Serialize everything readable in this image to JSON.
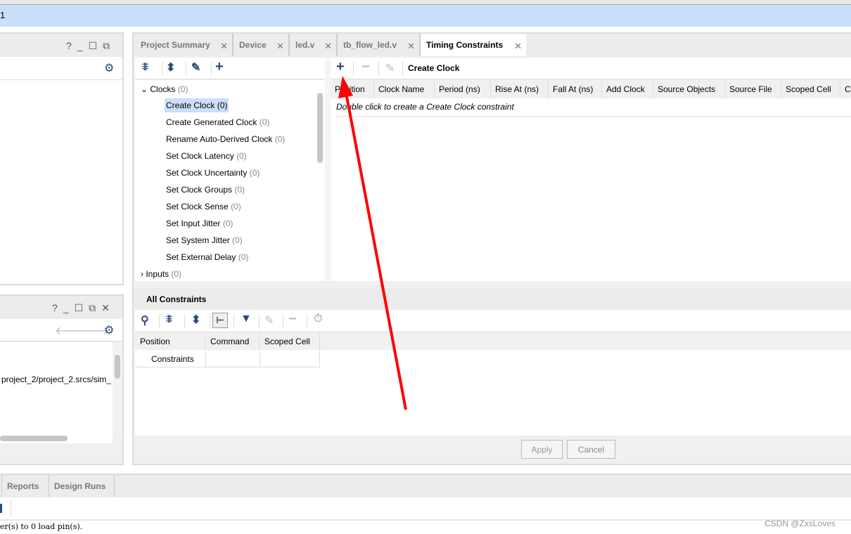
{
  "window": {
    "title_fragment": "1"
  },
  "left_top_panel": {
    "controls": [
      "?",
      "_",
      "☐",
      "⧉"
    ]
  },
  "left_bottom_panel": {
    "controls": [
      "?",
      "_",
      "☐",
      "⧉",
      "✕"
    ],
    "path_text": "project_2/project_2.srcs/sim_"
  },
  "main": {
    "tabs": [
      {
        "label": "Project Summary"
      },
      {
        "label": "Device"
      },
      {
        "label": "led.v"
      },
      {
        "label": "tb_flow_led.v"
      },
      {
        "label": "Timing Constraints",
        "active": true
      }
    ],
    "tree": {
      "groups": [
        {
          "label": "Clocks",
          "count": "(0)"
        },
        {
          "label": "Inputs",
          "count": "(0)"
        }
      ],
      "items": [
        {
          "label": "Create Clock (0)",
          "selected": true
        },
        {
          "label": "Create Generated Clock",
          "count": "(0)"
        },
        {
          "label": "Rename Auto-Derived Clock",
          "count": "(0)"
        },
        {
          "label": "Set Clock Latency",
          "count": "(0)"
        },
        {
          "label": "Set Clock Uncertainty",
          "count": "(0)"
        },
        {
          "label": "Set Clock Groups",
          "count": "(0)"
        },
        {
          "label": "Set Clock Sense",
          "count": "(0)"
        },
        {
          "label": "Set Input Jitter",
          "count": "(0)"
        },
        {
          "label": "Set System Jitter",
          "count": "(0)"
        },
        {
          "label": "Set External Delay",
          "count": "(0)"
        }
      ]
    },
    "detail": {
      "title": "Create Clock",
      "columns": [
        "Position",
        "Clock Name",
        "Period (ns)",
        "Rise At (ns)",
        "Fall At (ns)",
        "Add Clock",
        "Source Objects",
        "Source File",
        "Scoped Cell",
        "C"
      ],
      "empty_hint": "Double click to create a Create Clock constraint"
    },
    "all_constraints": {
      "title": "All Constraints",
      "columns": [
        "Position",
        "Command",
        "Scoped Cell"
      ],
      "rows": [
        [
          "Constraints",
          "",
          ""
        ]
      ]
    },
    "buttons": {
      "apply": "Apply",
      "cancel": "Cancel"
    }
  },
  "bottom": {
    "tabs": [
      "Reports",
      "Design Runs"
    ],
    "console": "er(s) to 0 load pin(s)."
  },
  "watermark": "CSDN @ZxsLoves",
  "colors": {
    "accent": "#2c4a7c",
    "selection": "#cbdffb",
    "annotation_arrow": "#ff0000"
  }
}
